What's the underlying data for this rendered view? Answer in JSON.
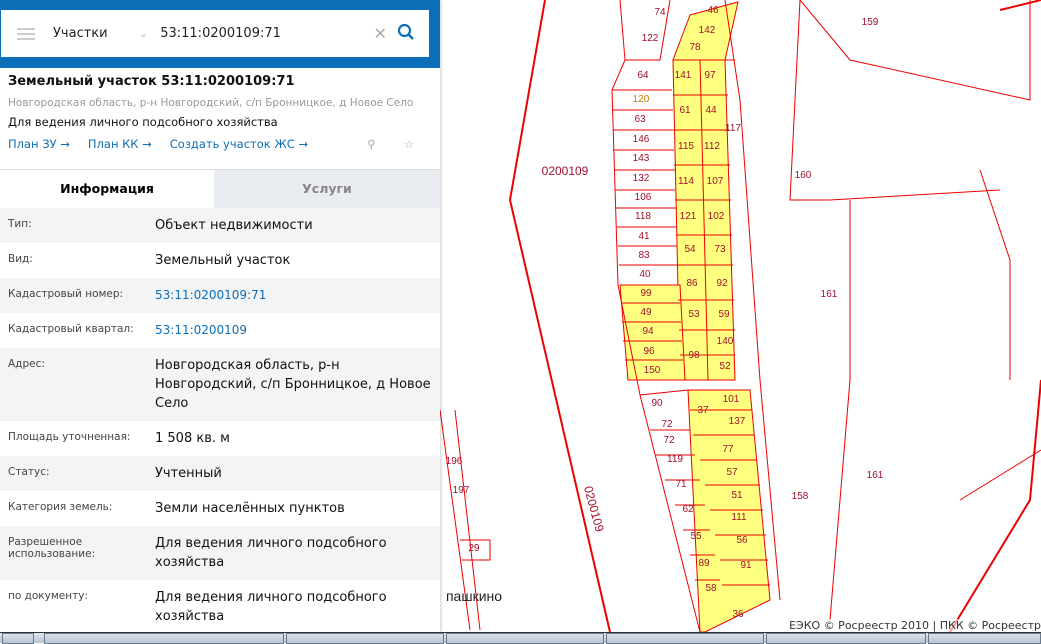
{
  "search": {
    "menu_icon": "hamburger-icon",
    "category": "Участки",
    "query": "53:11:0200109:71",
    "clear_icon": "close-icon",
    "search_icon": "search-icon"
  },
  "card": {
    "title": "Земельный участок 53:11:0200109:71",
    "address": "Новгородская область, р-н Новгородский, с/п Бронницкое, д Новое Село",
    "purpose": "Для ведения личного подсобного хозяйства",
    "links": [
      "План ЗУ →",
      "План КК →",
      "Создать участок ЖС →"
    ]
  },
  "tabs": [
    "Информация",
    "Услуги"
  ],
  "info": [
    {
      "label": "Тип:",
      "value": "Объект недвижимости"
    },
    {
      "label": "Вид:",
      "value": "Земельный участок"
    },
    {
      "label": "Кадастровый номер:",
      "value": "53:11:0200109:71",
      "link": true
    },
    {
      "label": "Кадастровый квартал:",
      "value": "53:11:0200109",
      "link": true
    },
    {
      "label": "Адрес:",
      "value": "Новгородская область, р-н Новгородский, с/п Бронницкое, д Новое Село"
    },
    {
      "label": "Площадь уточненная:",
      "value": "1 508 кв. м"
    },
    {
      "label": "Статус:",
      "value": "Учтенный"
    },
    {
      "label": "Категория земель:",
      "value": "Земли населённых пунктов"
    },
    {
      "label": "Разрешенное использование:",
      "value": "Для ведения личного подсобного хозяйства"
    },
    {
      "label": "по документу:",
      "value": "Для ведения личного подсобного хозяйства"
    }
  ],
  "map": {
    "labels": [
      "74",
      "46",
      "122",
      "142",
      "78",
      "159",
      "64",
      "141",
      "97",
      "120",
      "61",
      "44",
      "63",
      "146",
      "115",
      "112",
      "117",
      "143",
      "132",
      "114",
      "107",
      "0200109",
      "160",
      "106",
      "121",
      "102",
      "118",
      "41",
      "54",
      "73",
      "83",
      "40",
      "86",
      "92",
      "161",
      "99",
      "49",
      "53",
      "59",
      "94",
      "140",
      "96",
      "98",
      "150",
      "52",
      "90",
      "37",
      "101",
      "72",
      "137",
      "72",
      "77",
      "119",
      "161",
      "57",
      "71",
      "51",
      "158",
      "62",
      "111",
      "55",
      "56",
      "89",
      "91",
      "58",
      "36",
      "196",
      "197",
      "29",
      "0200109",
      "пашкино"
    ],
    "copyright": "ЕЭКО © Росреестр 2010 | ПКК © Росреестр"
  }
}
